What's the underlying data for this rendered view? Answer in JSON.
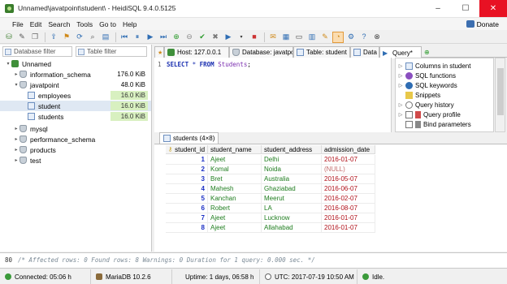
{
  "window": {
    "title": "Unnamed\\javatpoint\\student\\ - HeidiSQL 9.4.0.5125",
    "minimize": "–",
    "maximize": "☐",
    "close": "✕"
  },
  "menu": {
    "items": [
      "File",
      "Edit",
      "Search",
      "Tools",
      "Go to",
      "Help"
    ],
    "donate": "Donate"
  },
  "toolbar": {
    "icons": [
      "connect-icon",
      "disconnect-icon",
      "copy-icon",
      "export-icon",
      "import-icon",
      "refresh-icon",
      "find-icon",
      "table-icon",
      "first-icon",
      "prev-icon",
      "next-icon",
      "last-icon",
      "add-icon",
      "remove-icon",
      "apply-icon",
      "cancel-icon",
      "run-icon",
      "run-dropdown-icon",
      "stop-icon",
      "format-icon",
      "save-icon",
      "load-icon",
      "grid-icon",
      "settings-icon",
      "zoom-icon",
      "filter-icon",
      "help-icon",
      "exit-icon"
    ]
  },
  "left_panel": {
    "database_filter_placeholder": "Database filter",
    "table_filter_placeholder": "Table filter",
    "tree": [
      {
        "label": "Unnamed",
        "level": 0,
        "icon": "server-icon",
        "arrow": "▾",
        "size": ""
      },
      {
        "label": "information_schema",
        "level": 1,
        "icon": "database-icon",
        "arrow": "▸",
        "size": "176.0 KiB"
      },
      {
        "label": "javatpoint",
        "level": 1,
        "icon": "database-icon",
        "arrow": "▾",
        "size": "48.0 KiB"
      },
      {
        "label": "employees",
        "level": 2,
        "icon": "table-icon",
        "arrow": "",
        "size": "16.0 KiB"
      },
      {
        "label": "student",
        "level": 2,
        "icon": "table-icon",
        "arrow": "",
        "size": "16.0 KiB"
      },
      {
        "label": "students",
        "level": 2,
        "icon": "table-icon",
        "arrow": "",
        "size": "16.0 KiB"
      },
      {
        "label": "mysql",
        "level": 1,
        "icon": "database-icon",
        "arrow": "▸",
        "size": ""
      },
      {
        "label": "performance_schema",
        "level": 1,
        "icon": "database-icon",
        "arrow": "▸",
        "size": ""
      },
      {
        "label": "products",
        "level": 1,
        "icon": "database-icon",
        "arrow": "▸",
        "size": ""
      },
      {
        "label": "test",
        "level": 1,
        "icon": "database-icon",
        "arrow": "▸",
        "size": ""
      }
    ],
    "selected": "student"
  },
  "tabs": [
    {
      "label": "Host: 127.0.0.1"
    },
    {
      "label": "Database: javatpoint"
    },
    {
      "label": "Table: student"
    },
    {
      "label": "Data"
    },
    {
      "label": "Query*"
    }
  ],
  "editor": {
    "line_number": "1",
    "keyword1": "SELECT",
    "operator": "*",
    "keyword2": "FROM",
    "table": "Students",
    "terminator": ";"
  },
  "helper": {
    "items": [
      "Columns in student",
      "SQL functions",
      "SQL keywords",
      "Snippets",
      "Query history",
      "Query profile",
      "Bind parameters"
    ]
  },
  "results": {
    "tab_label": "students (4×8)",
    "columns": [
      "student_id",
      "student_name",
      "student_address",
      "admission_date"
    ],
    "rows": [
      [
        "1",
        "Ajeet",
        "Delhi",
        "2016-01-07"
      ],
      [
        "2",
        "Komal",
        "Noida",
        "(NULL)"
      ],
      [
        "3",
        "Bret",
        "Australia",
        "2016-05-07"
      ],
      [
        "4",
        "Mahesh",
        "Ghaziabad",
        "2016-06-07"
      ],
      [
        "5",
        "Kanchan",
        "Meerut",
        "2016-02-07"
      ],
      [
        "6",
        "Robert",
        "LA",
        "2016-08-07"
      ],
      [
        "7",
        "Ajeet",
        "Lucknow",
        "2016-01-07"
      ],
      [
        "8",
        "Ajeet",
        "Allahabad",
        "2016-01-07"
      ]
    ]
  },
  "log": {
    "line_number": "80",
    "message": "/* Affected rows: 0  Found rows: 8  Warnings: 0  Duration for 1 query: 0.000 sec. */"
  },
  "status": {
    "connected": "Connected: 05:06 h",
    "server": "MariaDB 10.2.6",
    "uptime": "Uptime: 1 days, 06:58 h",
    "utc": "UTC: 2017-07-19 10:50 AM",
    "state": "Idle."
  },
  "colors": {
    "accent_selected": "#dfe8f3",
    "size_highlight": "#d8f0c0",
    "keyword": "#1a2fb0",
    "table_name": "#7b2fb0",
    "id_value": "#1b2fc4",
    "text_value": "#1f7d1f",
    "date_value": "#b0111a"
  }
}
